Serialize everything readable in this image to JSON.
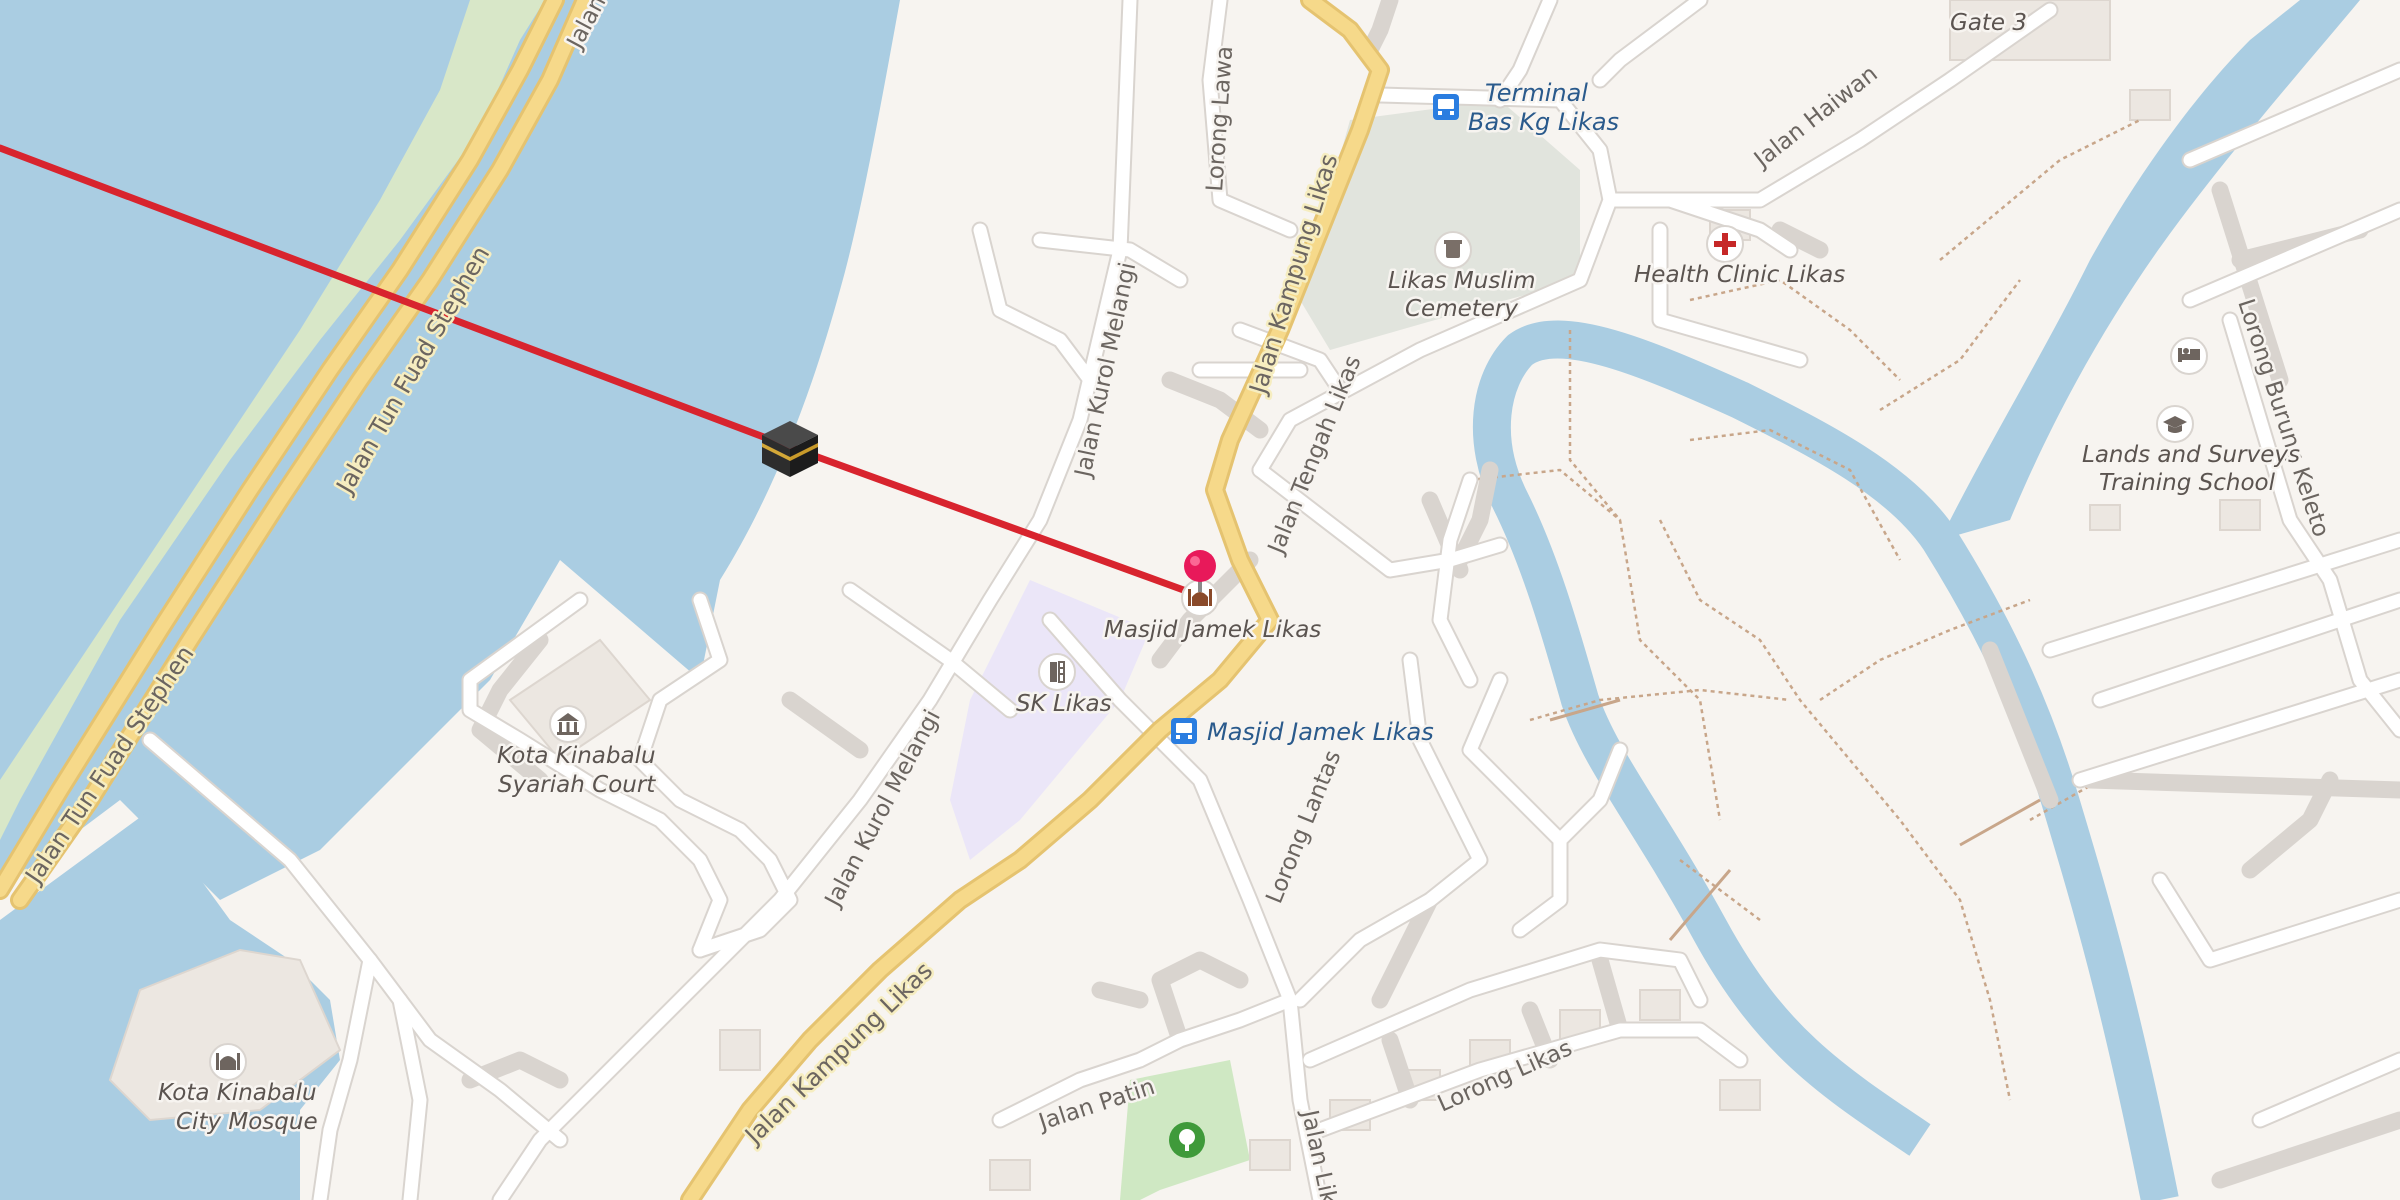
{
  "map": {
    "roads": {
      "tun_fuad_stephen_top": "Jalan",
      "tun_fuad_stephen_mid": "Jalan Tun Fuad Stephen",
      "tun_fuad_stephen_low": "Jalan Tun Fuad Stephen",
      "kampung_likas_north": "Jalan Kampung Likas",
      "kampung_likas_south": "Jalan Kampung Likas",
      "kurol_melangi_north": "Jalan Kurol Melangi",
      "kurol_melangi_south": "Jalan Kurol Melangi",
      "lorong_lawa": "Lorong Lawa",
      "tengah_likas": "Jalan Tengah Likas",
      "haiwan": "Jalan Haiwan",
      "burung_keleto": "Lorong Burung Keleto",
      "lantas": "Lorong Lantas",
      "patin": "Jalan Patin",
      "lorong_likas": "Lorong Likas",
      "jalan_lik": "Jalan Lik"
    },
    "pois": {
      "gate": "Gate 3",
      "terminal_line1": "Terminal",
      "terminal_line2": "Bas Kg Likas",
      "cemetery_line1": "Likas Muslim",
      "cemetery_line2": "Cemetery",
      "clinic": "Health Clinic Likas",
      "lands_line1": "Lands and Surveys",
      "lands_line2": "Training School",
      "masjid": "Masjid Jamek Likas",
      "school": "SK Likas",
      "bus_stop": "Masjid Jamek Likas",
      "court_line1": "Kota Kinabalu",
      "court_line2": "Syariah Court",
      "city_mosque_line1": "Kota Kinabalu",
      "city_mosque_line2": "City Mosque"
    },
    "icons": {
      "bus": "bus-stop-icon",
      "cemetery": "cemetery-icon",
      "clinic": "medical-cross-icon",
      "lodging": "bed-icon",
      "education": "graduation-cap-icon",
      "mosque": "mosque-icon",
      "school": "school-icon",
      "court": "courthouse-icon",
      "kaaba": "kaaba-icon",
      "pin": "location-pin-icon",
      "park": "tree-icon"
    },
    "colors": {
      "water": "#aacde2",
      "land": "#f7f4f0",
      "major_road": "#f6d98a",
      "qibla_line": "#d8242e",
      "pin": "#e8195a",
      "school_area": "#ebe6f8",
      "cemetery_area": "#e1e4dd",
      "park_area": "#cfe8c3"
    }
  }
}
